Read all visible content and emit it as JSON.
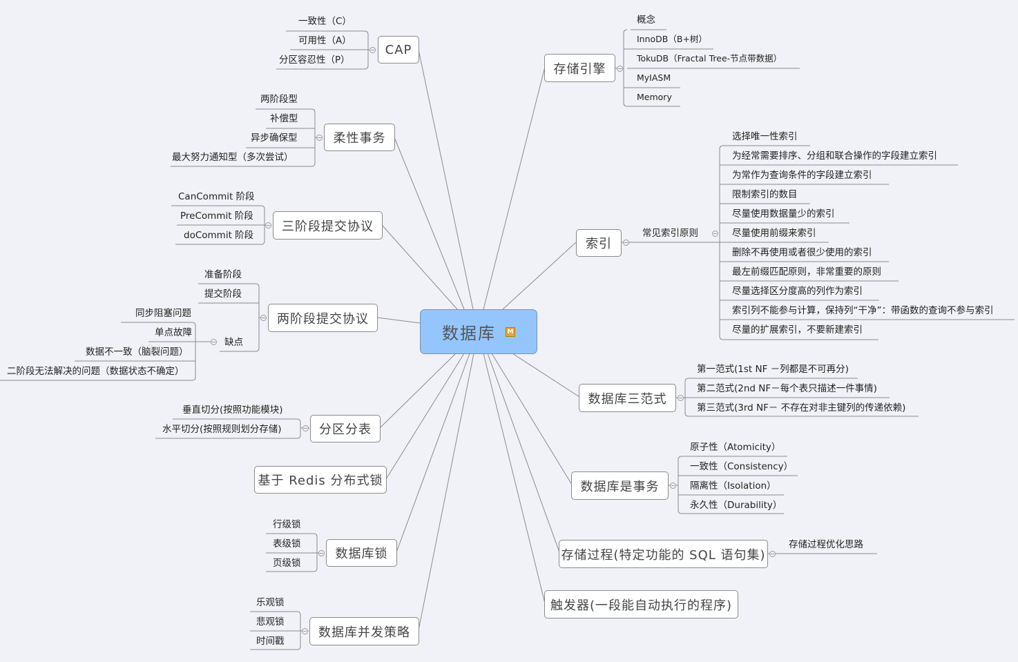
{
  "root": {
    "label": "数据库",
    "marker": "M"
  },
  "colors": {
    "root_fill": "#94c6fd",
    "background": "#f1f2f7",
    "line": "#8a8a8a"
  },
  "left": {
    "cap": {
      "label": "CAP",
      "children": [
        "一致性（C）",
        "可用性（A）",
        "分区容忍性（P）"
      ]
    },
    "flexible_tx": {
      "label": "柔性事务",
      "children": [
        "两阶段型",
        "补偿型",
        "异步确保型",
        "最大努力通知型（多次尝试）"
      ]
    },
    "three_pc": {
      "label": "三阶段提交协议",
      "children": [
        "CanCommit 阶段",
        "PreCommit 阶段",
        "doCommit 阶段"
      ]
    },
    "two_pc": {
      "label": "两阶段提交协议",
      "children": [
        "准备阶段",
        "提交阶段"
      ],
      "drawbacks": {
        "label": "缺点",
        "children": [
          "同步阻塞问题",
          "单点故障",
          "数据不一致（脑裂问题）",
          "二阶段无法解决的问题（数据状态不确定）"
        ]
      }
    },
    "sharding": {
      "label": "分区分表",
      "children": [
        "垂直切分(按照功能模块)",
        "水平切分(按照规则划分存储)"
      ]
    },
    "redis_lock": {
      "label": "基于 Redis 分布式锁"
    },
    "db_lock": {
      "label": "数据库锁",
      "children": [
        "行级锁",
        "表级锁",
        "页级锁"
      ]
    },
    "concurrency": {
      "label": "数据库并发策略",
      "children": [
        "乐观锁",
        "悲观锁",
        "时间戳"
      ]
    }
  },
  "right": {
    "engine": {
      "label": "存储引擎",
      "children": [
        "概念",
        "InnoDB（B+树）",
        "TokuDB（Fractal Tree-节点带数据）",
        "MyIASM",
        "Memory"
      ]
    },
    "index": {
      "label": "索引",
      "principles": {
        "label": "常见索引原则",
        "children": [
          "选择唯一性索引",
          "为经常需要排序、分组和联合操作的字段建立索引",
          "为常作为查询条件的字段建立索引",
          "限制索引的数目",
          "尽量使用数据量少的索引",
          "尽量使用前缀来索引",
          "删除不再使用或者很少使用的索引",
          "最左前缀匹配原则，非常重要的原则",
          "尽量选择区分度高的列作为索引",
          "索引列不能参与计算，保持列“干净”：带函数的查询不参与索引",
          "尽量的扩展索引，不要新建索引"
        ]
      }
    },
    "normal_forms": {
      "label": "数据库三范式",
      "children": [
        "第一范式(1st NF －列都是不可再分)",
        "第二范式(2nd NF－每个表只描述一件事情)",
        "第三范式(3rd NF－ 不存在对非主键列的传递依赖)"
      ]
    },
    "db_tx": {
      "label": "数据库是事务",
      "children": [
        "原子性（Atomicity）",
        "一致性（Consistency）",
        "隔离性（Isolation）",
        "永久性（Durability）"
      ]
    },
    "procedure": {
      "label": "存储过程(特定功能的 SQL 语句集)",
      "children": [
        "存储过程优化思路"
      ]
    },
    "trigger": {
      "label": "触发器(一段能自动执行的程序)"
    }
  }
}
